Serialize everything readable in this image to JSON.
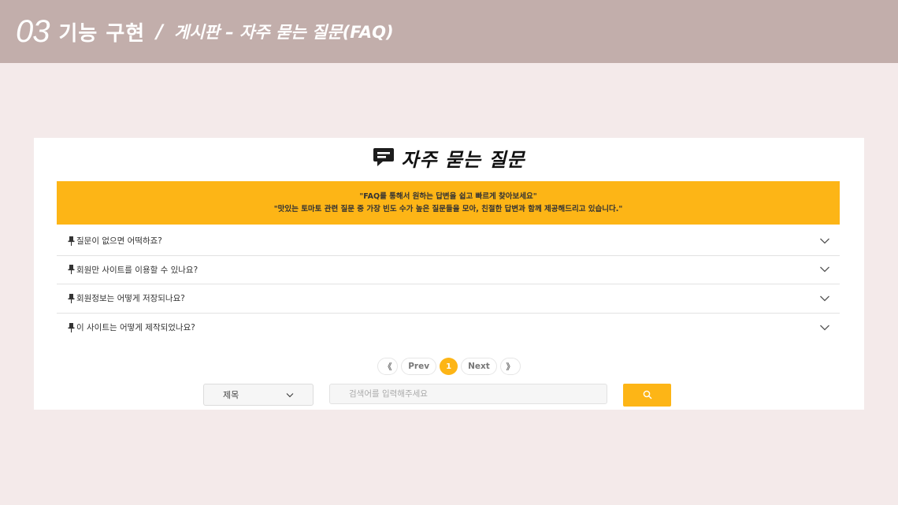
{
  "header": {
    "number": "03",
    "title": "기능 구현",
    "slash": "/",
    "subtitle": "게시판 – 자주 묻는 질문(FAQ)"
  },
  "faq": {
    "heading": "자주 묻는 질문",
    "heading_icon": "chat-bubble-icon",
    "banner_line1": "\"FAQ를 통해서 원하는 답변을 쉽고 빠르게 찾아보세요\"",
    "banner_line2": "\"맛있는 토마토 관련 질문 중 가장 빈도 수가 높은 질문들을 모아, 친절한 답변과 함께 제공해드리고 있습니다.\"",
    "questions": [
      "질문이 없으면 어떡하죠?",
      "회원만 사이트를 이용할 수 있나요?",
      "회원정보는 어떻게 저장되나요?",
      "이 사이트는 어떻게 제작되었나요?"
    ],
    "pagination": {
      "first": "《",
      "prev": "Prev",
      "current": "1",
      "next": "Next",
      "last": "》"
    },
    "search": {
      "select_value": "제목",
      "placeholder": "검색어를 입력해주세요",
      "button_icon": "search-icon"
    }
  },
  "colors": {
    "header_bg": "#c2aeab",
    "page_bg": "#f4eaea",
    "accent": "#fdb516"
  }
}
